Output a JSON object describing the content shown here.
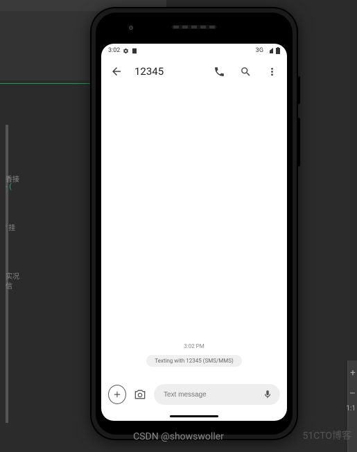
{
  "background": {
    "code_fragments": [
      "香接",
      "- (",
      "' 挂",
      "实况",
      "信"
    ],
    "right_panel": [
      "+",
      "–",
      "1:1"
    ]
  },
  "phone": {
    "status": {
      "time": "3:02",
      "network": "3G"
    },
    "conversation": {
      "contact": "12345",
      "timestamp": "3:02 PM",
      "info_chip": "Texting with 12345 (SMS/MMS)"
    },
    "compose": {
      "placeholder": "Text message"
    }
  },
  "watermarks": {
    "csdn": "CSDN @showswoller",
    "cto": "51CTO博客"
  }
}
